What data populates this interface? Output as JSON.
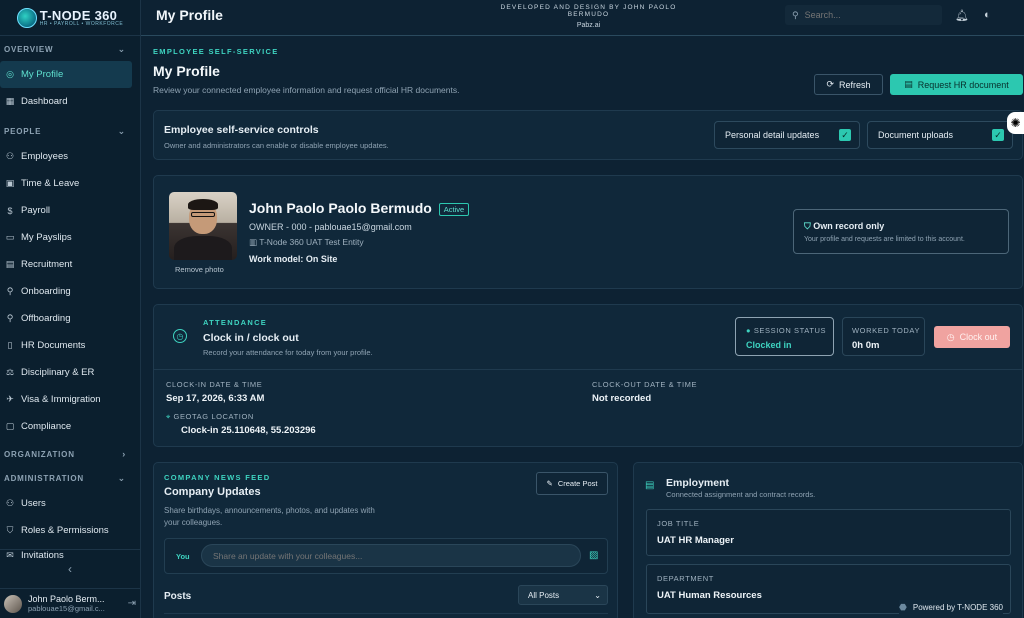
{
  "app": {
    "logo_text": "T-NODE 360",
    "logo_tagline": "HR • PAYROLL • WORKFORCE"
  },
  "topbar": {
    "title": "My Profile",
    "credit_line": "DEVELOPED AND DESIGN BY JOHN PAOLO BERMUDO",
    "credit_sub": "Pabz.ai",
    "search_placeholder": "Search..."
  },
  "sidebar": {
    "sections": {
      "overview": "OVERVIEW",
      "people": "PEOPLE",
      "organization": "ORGANIZATION",
      "administration": "ADMINISTRATION"
    },
    "overview_items": [
      {
        "label": "My Profile"
      },
      {
        "label": "Dashboard"
      }
    ],
    "people_items": [
      {
        "label": "Employees"
      },
      {
        "label": "Time & Leave"
      },
      {
        "label": "Payroll"
      },
      {
        "label": "My Payslips"
      },
      {
        "label": "Recruitment"
      },
      {
        "label": "Onboarding"
      },
      {
        "label": "Offboarding"
      },
      {
        "label": "HR Documents"
      },
      {
        "label": "Disciplinary & ER"
      },
      {
        "label": "Visa & Immigration"
      },
      {
        "label": "Compliance"
      }
    ],
    "admin_items": [
      {
        "label": "Users"
      },
      {
        "label": "Roles & Permissions"
      },
      {
        "label": "Invitations"
      }
    ],
    "user": {
      "name": "John Paolo Berm...",
      "email": "pablouae15@gmail.c..."
    }
  },
  "header": {
    "eyebrow": "EMPLOYEE SELF-SERVICE",
    "title": "My Profile",
    "subtitle": "Review your connected employee information and request official HR documents.",
    "refresh_label": "Refresh",
    "request_label": "Request HR document"
  },
  "controls": {
    "title": "Employee self-service controls",
    "subtitle": "Owner and administrators can enable or disable employee updates.",
    "personal_label": "Personal detail updates",
    "uploads_label": "Document uploads"
  },
  "profile": {
    "name": "John Paolo Paolo Bermudo",
    "status": "Active",
    "role_line": "OWNER - 000 - pablouae15@gmail.com",
    "entity": "T-Node 360 UAT Test Entity",
    "work_model": "Work model: On Site",
    "remove_photo": "Remove photo",
    "own_title": "Own record only",
    "own_sub": "Your profile and requests are limited to this account."
  },
  "attendance": {
    "eyebrow": "ATTENDANCE",
    "title": "Clock in / clock out",
    "subtitle": "Record your attendance for today from your profile.",
    "session_label": "SESSION STATUS",
    "session_value": "Clocked in",
    "worked_label": "WORKED TODAY",
    "worked_value": "0h 0m",
    "clockout_label": "Clock out",
    "clockin_dt_label": "CLOCK-IN DATE & TIME",
    "clockin_dt_value": "Sep 17, 2026, 6:33 AM",
    "clockout_dt_label": "CLOCK-OUT DATE & TIME",
    "clockout_dt_value": "Not recorded",
    "geotag_label": "GEOTAG LOCATION",
    "geotag_value": "Clock-in 25.110648, 55.203296"
  },
  "news": {
    "eyebrow": "COMPANY NEWS FEED",
    "title": "Company Updates",
    "subtitle": "Share birthdays, announcements, photos, and updates with your colleagues.",
    "create_label": "Create Post",
    "you_label": "You",
    "share_placeholder": "Share an update with your colleagues...",
    "posts_label": "Posts",
    "filter_value": "All Posts"
  },
  "employment": {
    "title": "Employment",
    "subtitle": "Connected assignment and contract records.",
    "job_title_label": "JOB TITLE",
    "job_title_value": "UAT HR Manager",
    "department_label": "DEPARTMENT",
    "department_value": "UAT Human Resources"
  },
  "footer": {
    "powered": "Powered by T-NODE 360"
  },
  "colors": {
    "accent": "#2cc8b0",
    "background": "#0d2233",
    "danger_button": "#f0a3a0"
  }
}
